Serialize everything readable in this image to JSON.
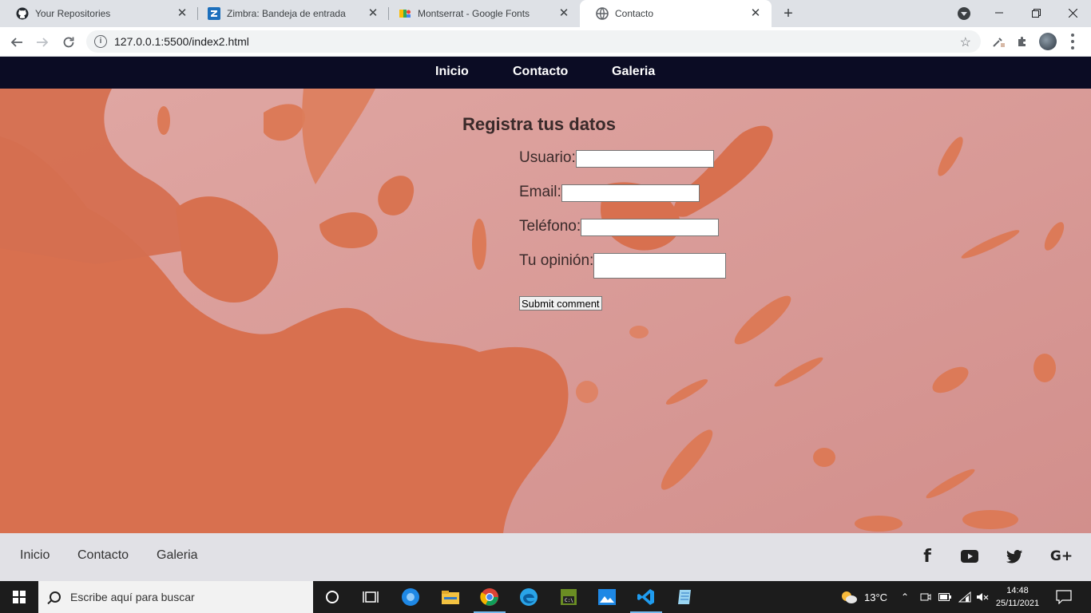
{
  "browser": {
    "tabs": [
      {
        "title": "Your Repositories",
        "icon": "github-icon",
        "active": false
      },
      {
        "title": "Zimbra: Bandeja de entrada",
        "icon": "zimbra-icon",
        "active": false
      },
      {
        "title": "Montserrat - Google Fonts",
        "icon": "google-fonts-icon",
        "active": false
      },
      {
        "title": "Contacto",
        "icon": "globe-icon",
        "active": true
      }
    ],
    "new_tab": "+",
    "url": "127.0.0.1:5500/index2.html"
  },
  "site": {
    "nav": {
      "inicio": "Inicio",
      "contacto": "Contacto",
      "galeria": "Galeria"
    },
    "form": {
      "title": "Registra tus datos",
      "usuario_label": "Usuario:",
      "email_label": "Email:",
      "telefono_label": "Teléfono:",
      "opinion_label": "Tu opinión:",
      "usuario_value": "",
      "email_value": "",
      "telefono_value": "",
      "opinion_value": "",
      "submit": "Submit comment"
    },
    "footer": {
      "inicio": "Inicio",
      "contacto": "Contacto",
      "galeria": "Galeria",
      "social": {
        "facebook": "f",
        "youtube": "youtube-icon",
        "twitter": "twitter-icon",
        "googleplus": "G+"
      }
    }
  },
  "taskbar": {
    "search_placeholder": "Escribe aquí para buscar",
    "weather": "13°C",
    "time": "14:48",
    "date": "25/11/2021"
  },
  "colors": {
    "nav_bg": "#0b0c24",
    "footer_bg": "#e1e1e6",
    "hero_base": "#d79a94",
    "hero_splash": "#d8704f"
  }
}
